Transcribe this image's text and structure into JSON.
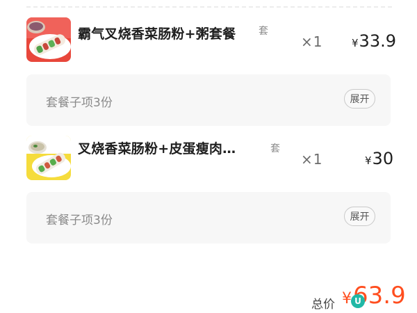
{
  "order_items": [
    {
      "title": "霸气叉烧香菜肠粉+粥套餐",
      "tag": "套",
      "quantity": "×1",
      "currency": "¥",
      "price": "33.9",
      "thumbnail_icon": "rice-noodle-roll-with-congee-image",
      "sub_items": {
        "label": "套餐子项3份",
        "expand_label": "展开"
      }
    },
    {
      "title": "叉烧香菜肠粉+皮蛋瘦肉…",
      "tag": "套",
      "quantity": "×1",
      "currency": "¥",
      "price": "30",
      "thumbnail_icon": "rice-noodle-roll-with-century-egg-congee-image",
      "sub_items": {
        "label": "套餐子项3份",
        "expand_label": "展开"
      }
    }
  ],
  "summary": {
    "total_label": "总价",
    "currency": "¥",
    "total_price": "63.9"
  },
  "watermark": {
    "logo_text": "U"
  },
  "colors": {
    "accent": "#ff4e1f",
    "sub_box_bg": "#f7f7f7",
    "muted_text": "#8a8a8a"
  }
}
